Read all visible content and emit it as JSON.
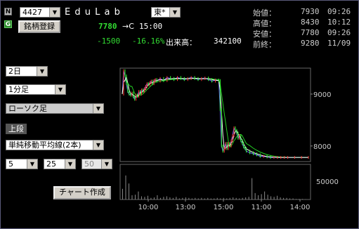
{
  "header": {
    "code_value": "4427",
    "company_name": "E d u L a b",
    "market_value": "東*",
    "n_badge": "N",
    "g_badge": "G",
    "register_button": "銘柄登録",
    "price": "7780",
    "arrow_label": "→C",
    "price_time": "15:00",
    "change": "-1500",
    "change_pct": "-16.16%",
    "volume_label": "出来高：",
    "volume_value": "342100"
  },
  "stats": [
    {
      "label": "始値：",
      "value": "7930",
      "time": "09:26"
    },
    {
      "label": "高値：",
      "value": "8430",
      "time": "10:12"
    },
    {
      "label": "安値：",
      "value": "7780",
      "time": "09:26"
    },
    {
      "label": "前終：",
      "value": "9280",
      "time": "11/09"
    }
  ],
  "controls": {
    "period": "2日",
    "interval": "1分足",
    "chart_type": "ローソク足",
    "upper_label": "上段",
    "indicator": "単純移動平均線(2本)",
    "ma1": "5",
    "ma2": "25",
    "ma3": "50",
    "create_button": "チャート作成"
  },
  "colors": {
    "price_line": "#6a6aff",
    "ma_short": "#ffffff",
    "ma_long": "#22cc22",
    "candle_up": "#ff3333",
    "candle_down": "#33ff33",
    "volume": "#888888"
  },
  "chart_data": {
    "type": "line",
    "y_ticks": [
      "9000",
      "8000"
    ],
    "volume_tick": "50000",
    "x_ticks": [
      "10:00",
      "13:00",
      "15:00",
      "11:00",
      "14:00"
    ],
    "ylim": [
      7700,
      9500
    ],
    "series": [
      {
        "x": [
          0,
          2,
          4,
          6,
          8,
          10,
          12,
          14,
          16,
          18,
          20,
          22,
          24,
          26,
          28,
          30,
          32,
          34,
          36,
          38,
          40,
          42,
          44,
          46,
          48,
          50,
          55,
          60,
          65,
          70,
          75,
          80,
          85,
          90,
          95,
          100,
          105,
          110,
          115,
          120,
          125,
          130,
          135,
          140,
          142,
          144,
          146,
          148,
          150,
          152,
          154,
          156,
          158,
          160,
          162,
          164,
          166,
          168,
          170,
          172,
          174,
          176,
          178,
          180,
          185,
          190,
          195,
          200,
          205,
          210,
          215,
          220,
          225,
          230,
          235,
          240,
          250,
          260,
          270
        ],
        "values": [
          9000,
          9450,
          9350,
          9200,
          9050,
          9000,
          8980,
          9020,
          8950,
          8900,
          8980,
          8960,
          9050,
          9000,
          9080,
          9050,
          9100,
          9150,
          9200,
          9180,
          9220,
          9250,
          9200,
          9260,
          9280,
          9250,
          9300,
          9260,
          9320,
          9300,
          9280,
          9320,
          9300,
          9280,
          9300,
          9320,
          9300,
          9280,
          9300,
          9310,
          9280,
          9250,
          9270,
          9260,
          8700,
          8000,
          7900,
          7950,
          8050,
          7950,
          8050,
          8000,
          8100,
          8200,
          8350,
          8300,
          8250,
          8150,
          8200,
          8100,
          8050,
          7980,
          7950,
          7900,
          7870,
          7850,
          7830,
          7800,
          7800,
          7790,
          7780,
          7780,
          7780,
          7780,
          7780,
          7780,
          7780,
          7780,
          7780
        ]
      }
    ],
    "volume": [
      20000,
      45000,
      30000,
      8000,
      9000,
      15000,
      6000,
      5000,
      7000,
      3000,
      4000,
      8000,
      3000,
      5000,
      6000,
      4000,
      3000,
      5000,
      2000,
      3000,
      4000,
      3000,
      2000,
      3000,
      2000,
      3000,
      2000,
      3000,
      2000,
      2000,
      3000,
      2000,
      3000,
      2000,
      3000,
      4000,
      3000,
      2000,
      3000,
      4000,
      5000,
      40000,
      12000,
      8000,
      10000,
      15000,
      9000,
      6000,
      5000,
      7000,
      4000,
      3000,
      3000,
      2000,
      2000,
      1000,
      1000,
      1000,
      500
    ]
  }
}
